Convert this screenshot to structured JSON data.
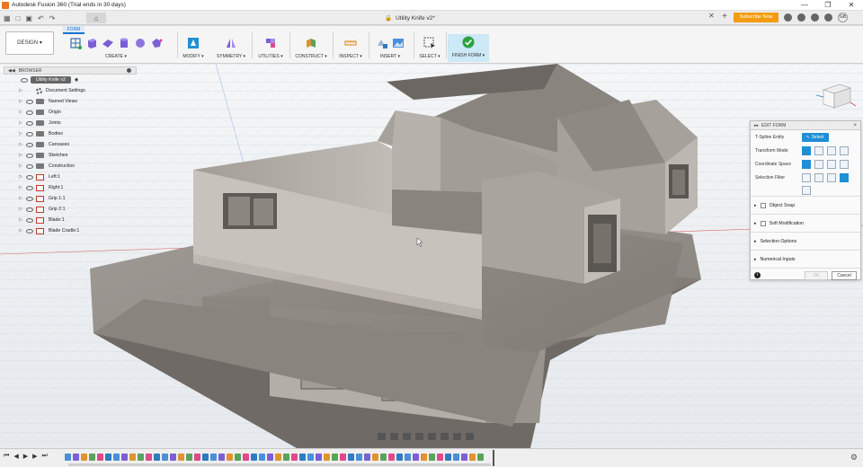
{
  "window": {
    "title": "Autodesk Fusion 360 (Trial ends in 30 days)",
    "controls": [
      "—",
      "❐",
      "✕"
    ]
  },
  "tabbar": {
    "document_title": "Utility Knife v2*",
    "close_symbol": "✕",
    "new_tab_symbol": "+",
    "subscribe_label": "Subscribe Now",
    "user_initials": "GB"
  },
  "ribbon": {
    "workspace_label": "DESIGN ▾",
    "active_tab": "FORM",
    "groups": {
      "create": "CREATE ▾",
      "modify": "MODIFY ▾",
      "symmetry": "SYMMETRY ▾",
      "utilities": "UTILITIES ▾",
      "construct": "CONSTRUCT ▾",
      "inspect": "INSPECT ▾",
      "insert": "INSERT ▾",
      "select": "SELECT ▾",
      "finish": "FINISH FORM ▾"
    }
  },
  "browser": {
    "title": "BROWSER",
    "root": "Utility Knife v2",
    "items": [
      {
        "label": "Document Settings",
        "kind": "settings"
      },
      {
        "label": "Named Views",
        "kind": "folder"
      },
      {
        "label": "Origin",
        "kind": "folder"
      },
      {
        "label": "Joints",
        "kind": "folder"
      },
      {
        "label": "Bodies",
        "kind": "folder"
      },
      {
        "label": "Canvases",
        "kind": "folder"
      },
      {
        "label": "Sketches",
        "kind": "folder"
      },
      {
        "label": "Construction",
        "kind": "folder"
      },
      {
        "label": "Left:1",
        "kind": "component"
      },
      {
        "label": "Right:1",
        "kind": "component"
      },
      {
        "label": "Grip 1:1",
        "kind": "component"
      },
      {
        "label": "Grip 2:1",
        "kind": "component"
      },
      {
        "label": "Blade:1",
        "kind": "component"
      },
      {
        "label": "Blade Cradle:1",
        "kind": "component"
      }
    ]
  },
  "edit_form": {
    "title": "EDIT FORM",
    "tspline_label": "T-Spline Entity",
    "select_button": "Select",
    "transform_mode": "Transform Mode",
    "coordinate_space": "Coordinate Space",
    "selection_filter": "Selection Filter",
    "sections": [
      "Object Snap",
      "Soft Modification",
      "Selection Options",
      "Numerical Inputs"
    ],
    "ok": "OK",
    "cancel": "Cancel"
  },
  "colors": {
    "accent": "#1f8fd6",
    "subscribe": "#f39c12",
    "model_wall": "#b9b3ad",
    "model_roof": "#8a847d",
    "model_dark": "#5c5853"
  }
}
